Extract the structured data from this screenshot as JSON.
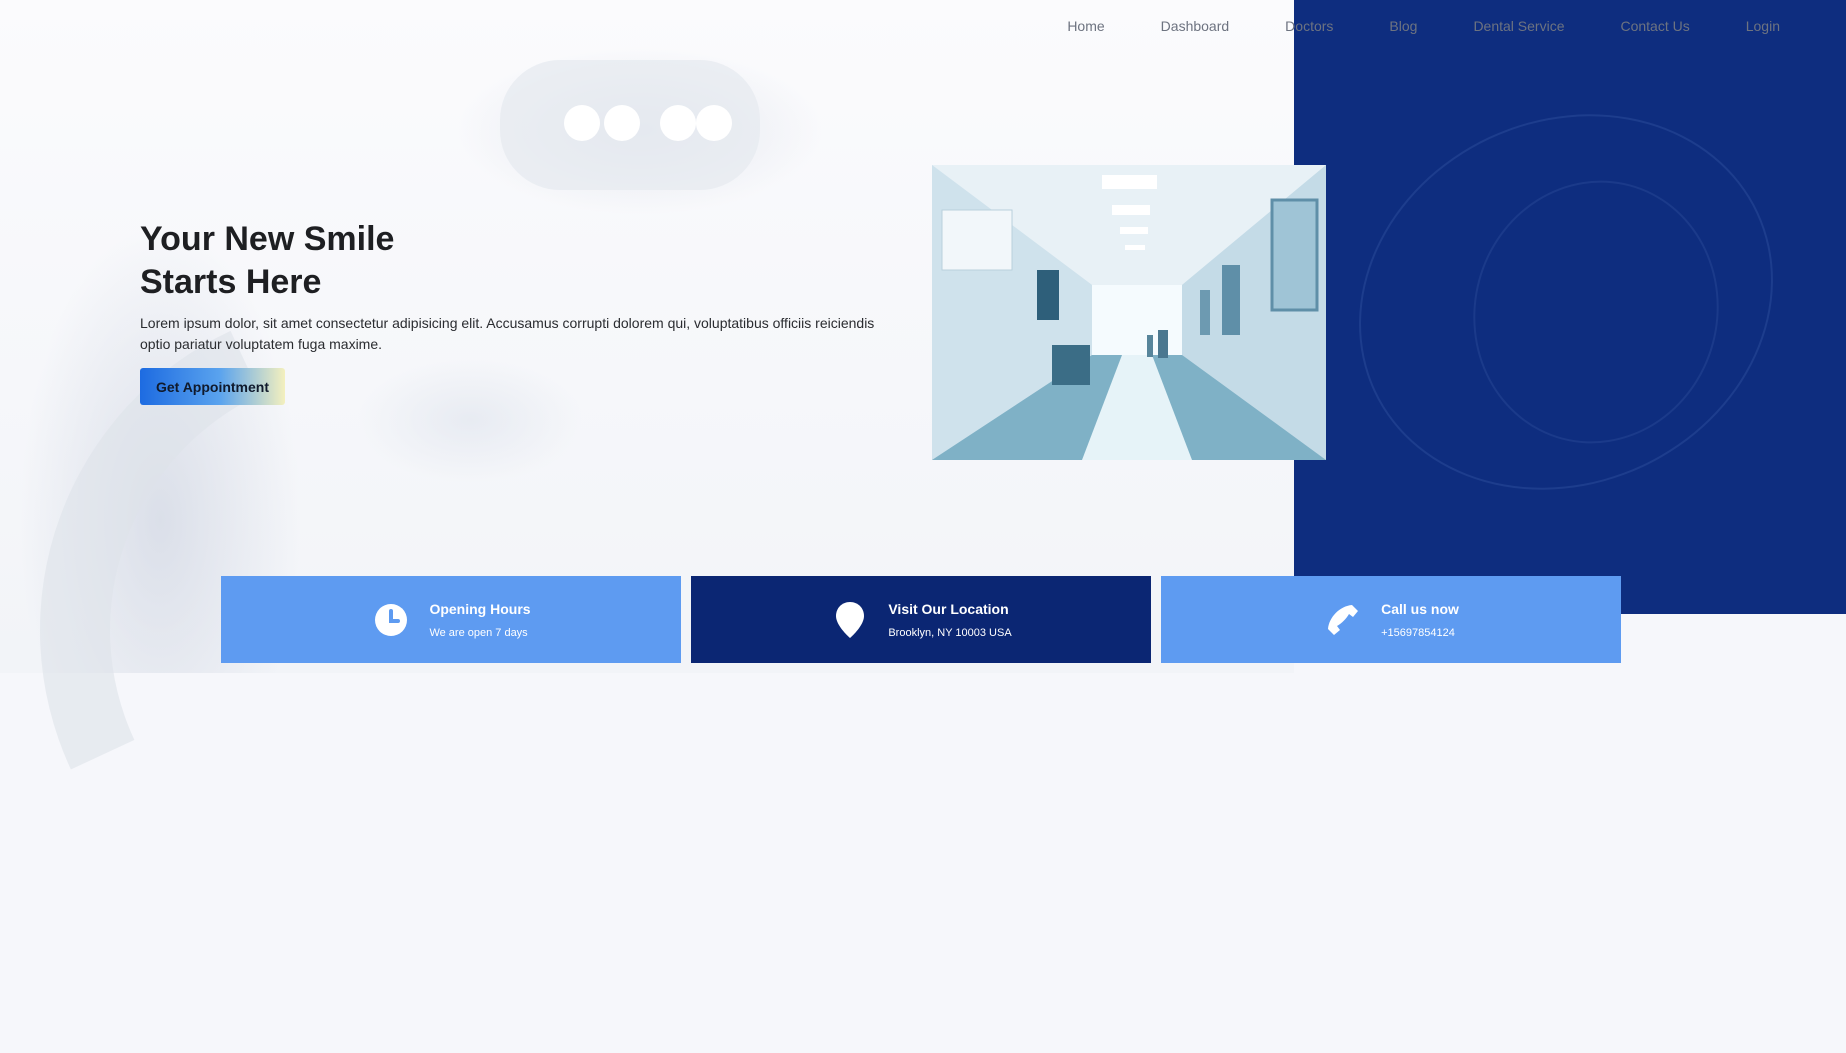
{
  "nav": {
    "items": [
      "Home",
      "Dashboard",
      "Doctors",
      "Blog",
      "Dental Service",
      "Contact Us",
      "Login"
    ]
  },
  "hero": {
    "title_line1": "Your New Smile",
    "title_line2": "Starts Here",
    "text": "Lorem ipsum dolor, sit amet consectetur adipisicing elit. Accusamus corrupti dolorem qui, voluptatibus officiis reiciendis optio pariatur voluptatem fuga maxime.",
    "cta_label": "Get Appointment"
  },
  "cards": [
    {
      "icon": "clock-icon",
      "title": "Opening Hours",
      "subtitle": "We are open 7 days"
    },
    {
      "icon": "location-pin-icon",
      "title": "Visit Our Location",
      "subtitle": "Brooklyn, NY 10003 USA"
    },
    {
      "icon": "phone-icon",
      "title": "Call us now",
      "subtitle": "+15697854124"
    }
  ],
  "colors": {
    "blue_panel": "#0e2d7f",
    "card_light": "#5e9bf1",
    "card_dark": "#0b2673"
  }
}
